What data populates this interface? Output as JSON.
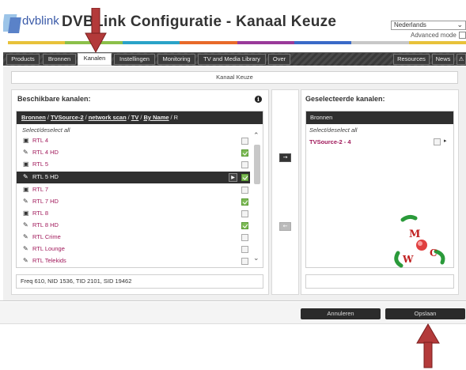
{
  "header": {
    "logo_text": "dvblink",
    "title": "DVBLink Configuratie - Kanaal Keuze",
    "language": "Nederlands",
    "advanced_mode_label": "Advanced mode"
  },
  "nav": {
    "tabs": [
      {
        "label": "Products"
      },
      {
        "label": "Bronnen"
      },
      {
        "label": "Kanalen",
        "active": true
      },
      {
        "label": "Instellingen"
      },
      {
        "label": "Monitoring"
      },
      {
        "label": "TV and Media Library"
      },
      {
        "label": "Over"
      }
    ],
    "right_tabs": [
      {
        "label": "Resources"
      },
      {
        "label": "News"
      }
    ]
  },
  "section_title": "Kanaal Keuze",
  "left_panel": {
    "title": "Beschikbare kanalen:",
    "breadcrumb": [
      "Bronnen",
      "TVSource-2",
      "network scan",
      "TV",
      "By Name",
      "R"
    ],
    "select_all": "Select/deselect all",
    "channels": [
      {
        "name": "RTL 4",
        "icon": "tv-icon",
        "checked": false
      },
      {
        "name": "RTL 4 HD",
        "icon": "wrench-icon",
        "checked": true
      },
      {
        "name": "RTL 5",
        "icon": "tv-icon",
        "checked": false
      },
      {
        "name": "RTL 5 HD",
        "icon": "wrench-icon",
        "checked": true,
        "highlighted": true
      },
      {
        "name": "RTL 7",
        "icon": "tv-icon",
        "checked": false
      },
      {
        "name": "RTL 7 HD",
        "icon": "wrench-icon",
        "checked": true
      },
      {
        "name": "RTL 8",
        "icon": "tv-icon",
        "checked": false
      },
      {
        "name": "RTL 8 HD",
        "icon": "wrench-icon",
        "checked": true
      },
      {
        "name": "RTL Crime",
        "icon": "wrench-icon",
        "checked": false
      },
      {
        "name": "RTL Lounge",
        "icon": "wrench-icon",
        "checked": false
      },
      {
        "name": "RTL Telekids",
        "icon": "wrench-icon",
        "checked": false
      }
    ],
    "freq_info": "Freq 610, NID 1536, TID 2101, SID 19462"
  },
  "right_panel": {
    "title": "Geselecteerde kanalen:",
    "header": "Bronnen",
    "select_all": "Select/deselect all",
    "items": [
      {
        "label": "TVSource-2 - 4"
      }
    ]
  },
  "watermark": {
    "letters": [
      "M",
      "W",
      "C"
    ]
  },
  "footer": {
    "cancel_label": "Annuleren",
    "save_label": "Opslaan"
  },
  "colors": {
    "channel_text": "#a0185a",
    "arrow": "#b33a3a",
    "check_green": "#7dbb55"
  }
}
